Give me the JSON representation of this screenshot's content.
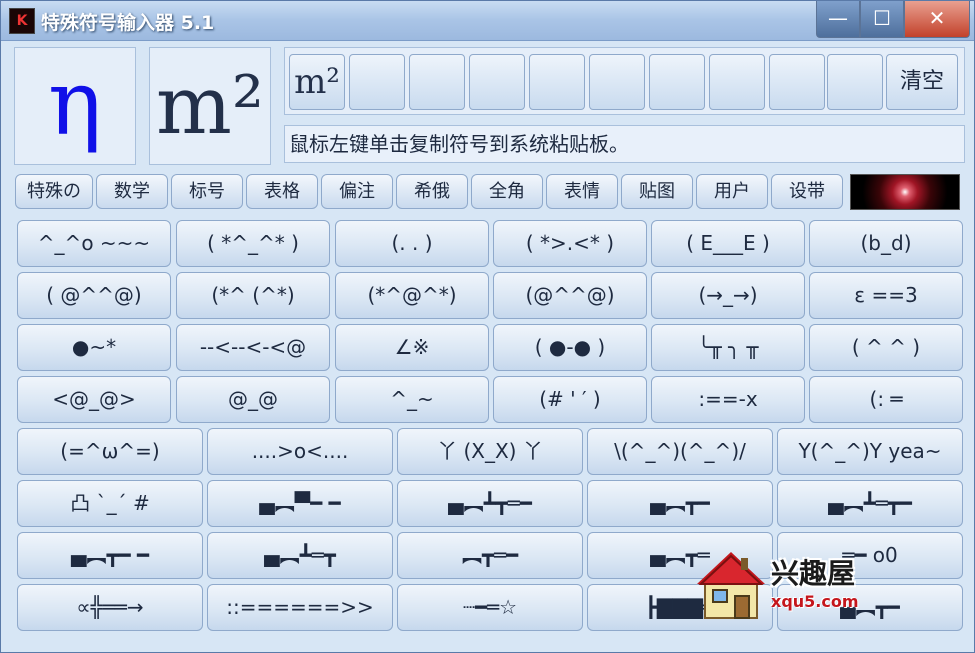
{
  "window": {
    "title": "特殊符号输入器 5.1",
    "app_icon_glyph": "K"
  },
  "controls": {
    "minimize": "—",
    "maximize": "☐",
    "close": "✕"
  },
  "preview": {
    "symbol": "η",
    "unit": "m²"
  },
  "history": {
    "cells": [
      "m²",
      "",
      "",
      "",
      "",
      "",
      "",
      "",
      "",
      ""
    ],
    "clear_label": "清空"
  },
  "hint": "鼠标左键单击复制符号到系统粘贴板。",
  "tabs": [
    "特殊の",
    "数学",
    "标号",
    "表格",
    "偏注",
    "希俄",
    "全角",
    "表情",
    "贴图",
    "用户",
    "设带"
  ],
  "symbols": {
    "row1": [
      "^_^o ~~~",
      "( *^_^* )",
      "(. . )",
      "( *>.<* )",
      "( E___E )",
      "(b_d)"
    ],
    "row2": [
      "( @^^@)",
      "(*^ (^*)",
      "(*^@^*)",
      "(@^^@)",
      "(→_→)",
      "ε ==3"
    ],
    "row3": [
      "●~*",
      "--<--<-<@",
      "∠※",
      "( ●-● )",
      "╰╥ ╮ ╥",
      "( ^ ^ )"
    ],
    "row4": [
      "<@_@>",
      "@_@",
      "^_~",
      "(# ' ′ )",
      ":==-x",
      "(: ═"
    ],
    "row5": [
      "(=^ω^=)",
      "....>o<....",
      "丫 (X_X) 丫",
      "\\(^_^)(^_^)/",
      "Y(^_^)Y yea~"
    ],
    "row6": [
      "凸 `_´ #",
      "▄︻▀━ ━",
      "▄︻┻┳═━",
      "▄︻┳━",
      "▄︻┻═┳━"
    ],
    "row7": [
      "▄︻┳━ ━",
      "▄︻┻═┳",
      "︻┳═━",
      "▄︻┳═",
      "═━ o0"
    ],
    "row8": [
      "∝╬══→",
      "::======>>",
      "┈━═☆",
      "┣▇▇▇═",
      "▄︻┳━"
    ]
  },
  "watermark": {
    "brand": "兴趣屋",
    "url": "xqu5.com"
  },
  "colors": {
    "accent": "#1010e8",
    "title_bar": "#a9c4e6",
    "close": "#c2412b"
  }
}
